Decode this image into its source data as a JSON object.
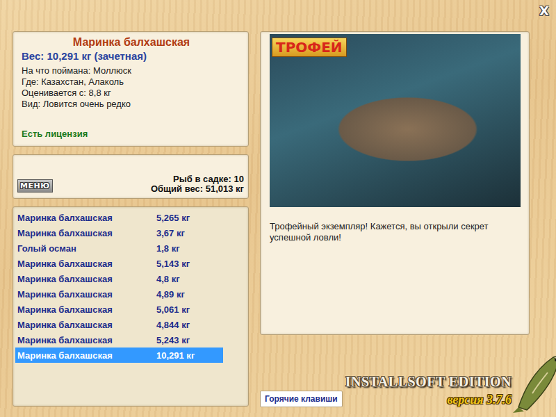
{
  "window": {
    "close": "X"
  },
  "fish": {
    "name": "Маринка балхашская",
    "weight": "Вес: 10,291 кг (зачетная)",
    "details": [
      "На что поймана: Моллюск",
      "Где: Казахстан, Алаколь",
      "Оценивается с: 8,8 кг",
      "Вид: Ловится очень редко"
    ],
    "license": "Есть лицензия"
  },
  "menu_button": "МЕНЮ",
  "keepnet": {
    "count": "Рыб в садке: 10",
    "total": "Общий вес: 51,013 кг"
  },
  "catches": [
    {
      "name": "Маринка балхашская",
      "weight": "5,265 кг",
      "selected": false
    },
    {
      "name": "Маринка балхашская",
      "weight": "3,67 кг",
      "selected": false
    },
    {
      "name": "Голый осман",
      "weight": "1,8 кг",
      "selected": false
    },
    {
      "name": "Маринка балхашская",
      "weight": "5,143 кг",
      "selected": false
    },
    {
      "name": "Маринка балхашская",
      "weight": "4,8 кг",
      "selected": false
    },
    {
      "name": "Маринка балхашская",
      "weight": "4,89 кг",
      "selected": false
    },
    {
      "name": "Маринка балхашская",
      "weight": "5,061 кг",
      "selected": false
    },
    {
      "name": "Маринка балхашская",
      "weight": "4,844 кг",
      "selected": false
    },
    {
      "name": "Маринка балхашская",
      "weight": "5,243 кг",
      "selected": false
    },
    {
      "name": "Маринка балхашская",
      "weight": "10,291 кг",
      "selected": true
    }
  ],
  "photo": {
    "badge": "ТРОФЕЙ"
  },
  "message": "Трофейный экземпляр! Кажется, вы открыли секрет успешной ловли!",
  "hotkeys_button": "Горячие клавиши",
  "brand": {
    "title": "INSTALLSOFT EDITION",
    "version": "версия 3.7.6"
  }
}
